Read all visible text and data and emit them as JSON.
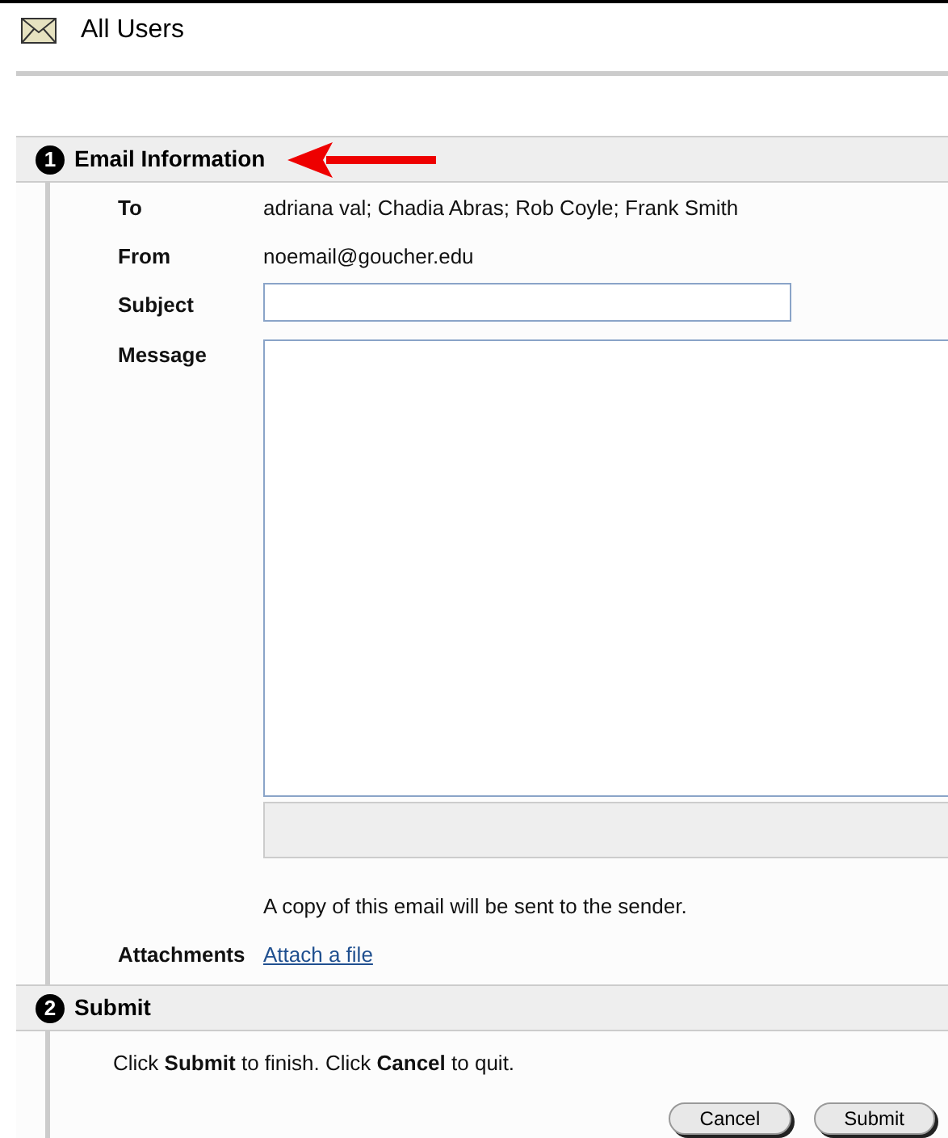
{
  "header": {
    "title": "All Users"
  },
  "sections": [
    {
      "number": "1",
      "title": "Email Information",
      "pointer_arrow": true
    },
    {
      "number": "2",
      "title": "Submit",
      "pointer_arrow": false
    }
  ],
  "fields": [
    {
      "kind": "text",
      "label": "To",
      "value": "adriana val; Chadia Abras; Rob Coyle; Frank Smith"
    },
    {
      "kind": "text",
      "label": "From",
      "value": "noemail@goucher.edu"
    },
    {
      "kind": "input",
      "label": "Subject"
    },
    {
      "kind": "textarea",
      "label": "Message"
    }
  ],
  "note": "A copy of this email will be sent to the sender.",
  "attachments": {
    "label": "Attachments",
    "link": "Attach a file"
  },
  "instructions": "Click **Submit** to finish. Click **Cancel** to quit.",
  "buttons": [
    "Cancel",
    "Submit"
  ]
}
